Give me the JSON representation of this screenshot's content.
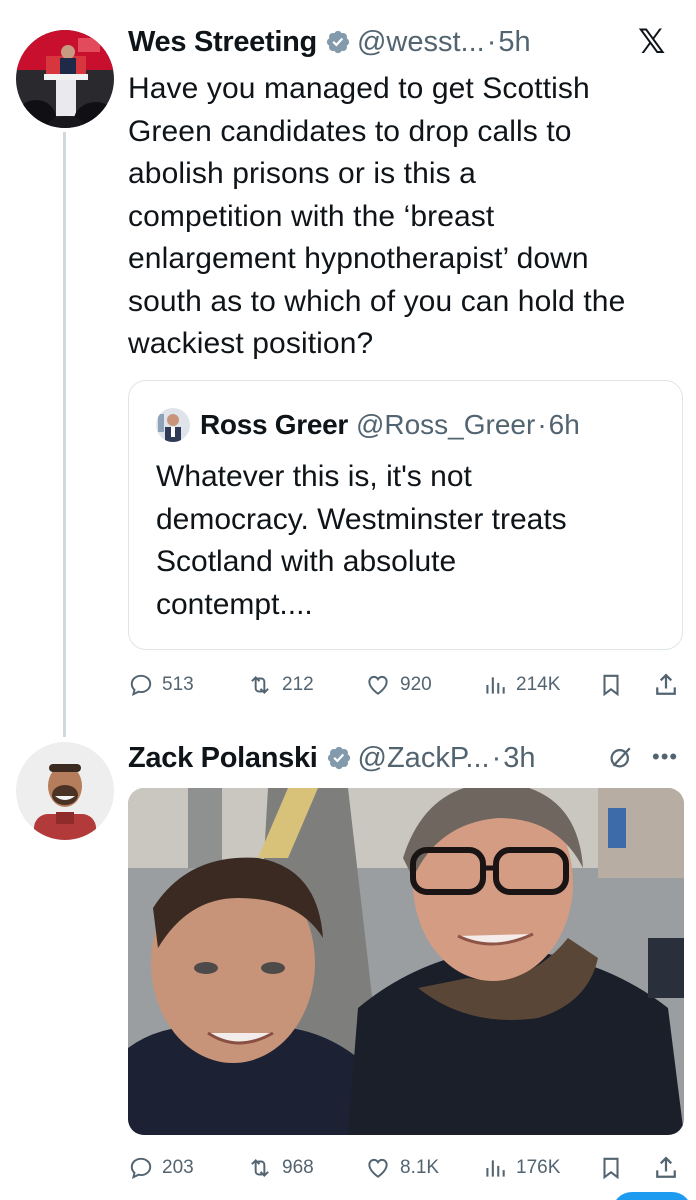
{
  "app": {
    "logo": "𝕏"
  },
  "tweets": [
    {
      "author": {
        "name": "Wes Streeting",
        "handle": "@wesst...",
        "time": "5h",
        "avatar": "wes-avatar"
      },
      "text": "Have you managed to get Scottish\nGreen candidates to drop calls to\nabolish prisons or is this a\ncompetition with the ‘breast\nenlargement hypnotherapist’ down\nsouth as to which of you can hold the\nwackiest position?",
      "quote": {
        "author": {
          "name": "Ross Greer",
          "handle": "@Ross_Greer",
          "time": "6h"
        },
        "text": "Whatever this is, it's not\ndemocracy. Westminster treats\nScotland with absolute\ncontempt...."
      },
      "metrics": {
        "replies": "513",
        "reposts": "212",
        "likes": "920",
        "views": "214K"
      }
    },
    {
      "author": {
        "name": "Zack Polanski",
        "handle": "@ZackP...",
        "time": "3h",
        "avatar": "zack-avatar"
      },
      "media": "photo-two-men-selfie",
      "metrics": {
        "replies": "203",
        "reposts": "968",
        "likes": "8.1K",
        "views": "176K"
      }
    }
  ],
  "colors": {
    "verified": "#829aab",
    "muted": "#536471",
    "border": "#dfe5e9",
    "accent": "#1d9bf0"
  }
}
